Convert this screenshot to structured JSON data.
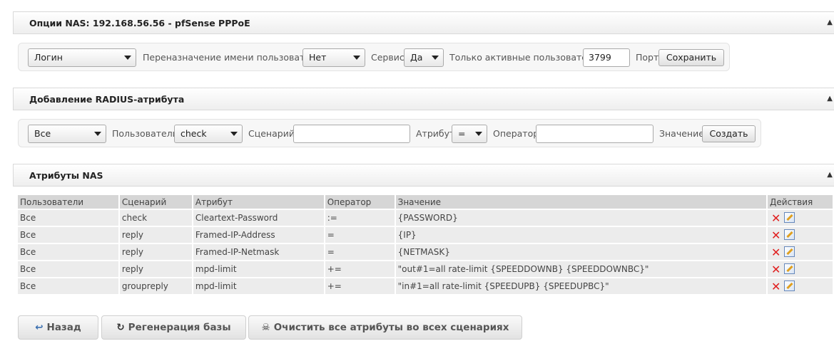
{
  "nas_options": {
    "title": "Опции NAS: 192.168.56.56 - pfSense PPPoE",
    "login_select": "Логин",
    "rename_label": "Переназначение имени пользователя",
    "rename_select": "Нет",
    "service_label": "Сервис",
    "service_select": "Да",
    "active_label": "Только активные пользователи",
    "port_value": "3799",
    "port_label": "Порт",
    "save_button": "Сохранить"
  },
  "add_attr": {
    "title": "Добавление RADIUS-атрибута",
    "users_select": "Все",
    "users_label": "Пользователи",
    "scenario_select": "check",
    "scenario_label": "Сценарий",
    "scenario_value": "",
    "attr_label": "Атрибут",
    "operator_select": "=",
    "operator_label": "Оператор",
    "operator_value": "",
    "value_label": "Значение",
    "create_button": "Создать"
  },
  "nas_attrs": {
    "title": "Атрибуты NAS",
    "columns": [
      "Пользователи",
      "Сценарий",
      "Атрибут",
      "Оператор",
      "Значение",
      "Действия"
    ],
    "rows": [
      [
        "Все",
        "check",
        "Cleartext-Password",
        ":=",
        "{PASSWORD}"
      ],
      [
        "Все",
        "reply",
        "Framed-IP-Address",
        "=",
        "{IP}"
      ],
      [
        "Все",
        "reply",
        "Framed-IP-Netmask",
        "=",
        "{NETMASK}"
      ],
      [
        "Все",
        "reply",
        "mpd-limit",
        "+=",
        "\"out#1=all rate-limit {SPEEDDOWNB} {SPEEDDOWNBC}\""
      ],
      [
        "Все",
        "groupreply",
        "mpd-limit",
        "+=",
        "\"in#1=all rate-limit {SPEEDUPB} {SPEEDUPBC}\""
      ]
    ]
  },
  "footer": {
    "back_button": "Назад",
    "regen_button": "Регенерация базы",
    "clear_button": "Очистить все атрибуты во всех сценариях"
  },
  "icons": {
    "collapse": "triangle-up-icon",
    "delete": "red-x-icon",
    "edit": "edit-pencil-icon",
    "back": "back-arrow-icon",
    "regen": "refresh-icon",
    "clear": "skull-icon"
  },
  "colors": {
    "delete": "#e02020",
    "header_bg": "#eeeeee",
    "table_header": "#d6d6d6",
    "table_row": "#ececec"
  }
}
